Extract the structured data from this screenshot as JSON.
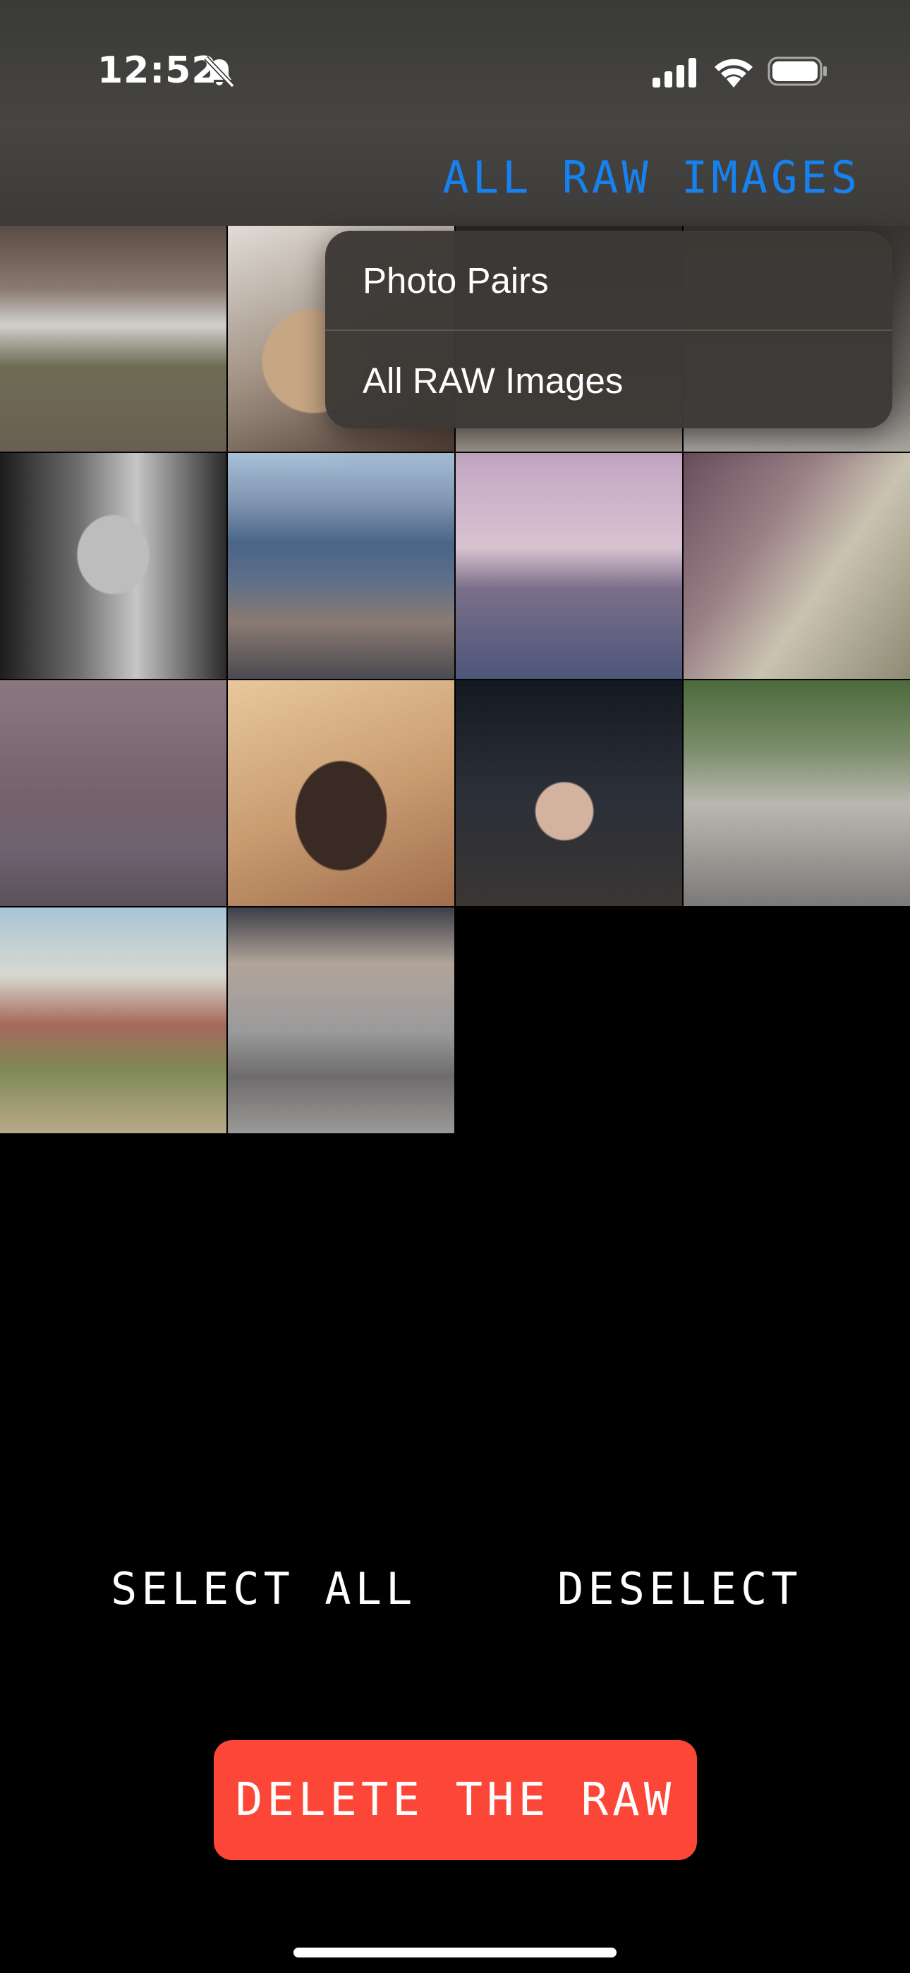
{
  "status_bar": {
    "time": "12:52",
    "icons": [
      "bell-slash-icon",
      "cellular-signal-icon",
      "wifi-icon",
      "battery-icon"
    ]
  },
  "header": {
    "mode_title": "ALL RAW IMAGES",
    "accent_color": "#1682f0"
  },
  "menu": {
    "items": [
      {
        "label": "Photo Pairs"
      },
      {
        "label": "All RAW Images"
      }
    ]
  },
  "photos": [
    {
      "subject": "railway-bridge",
      "selected": false
    },
    {
      "subject": "hand-holding-food",
      "selected": false
    },
    {
      "subject": "interior",
      "selected": false
    },
    {
      "subject": "interior-dark",
      "selected": false
    },
    {
      "subject": "bw-portrait",
      "selected": true
    },
    {
      "subject": "city-aerial",
      "selected": true
    },
    {
      "subject": "palm-lagoon",
      "selected": true
    },
    {
      "subject": "film-strip",
      "selected": true
    },
    {
      "subject": "building-courtyard",
      "selected": true
    },
    {
      "subject": "shadow-on-wall",
      "selected": true
    },
    {
      "subject": "woman-in-cafe",
      "selected": true
    },
    {
      "subject": "boy-on-bicycle",
      "selected": true
    },
    {
      "subject": "desert-mountains",
      "selected": false
    },
    {
      "subject": "couple-on-bench",
      "selected": false
    }
  ],
  "actions": {
    "select_all": "SELECT ALL",
    "deselect": "DESELECT",
    "delete": "DELETE THE RAW",
    "delete_color": "#fc4738"
  }
}
